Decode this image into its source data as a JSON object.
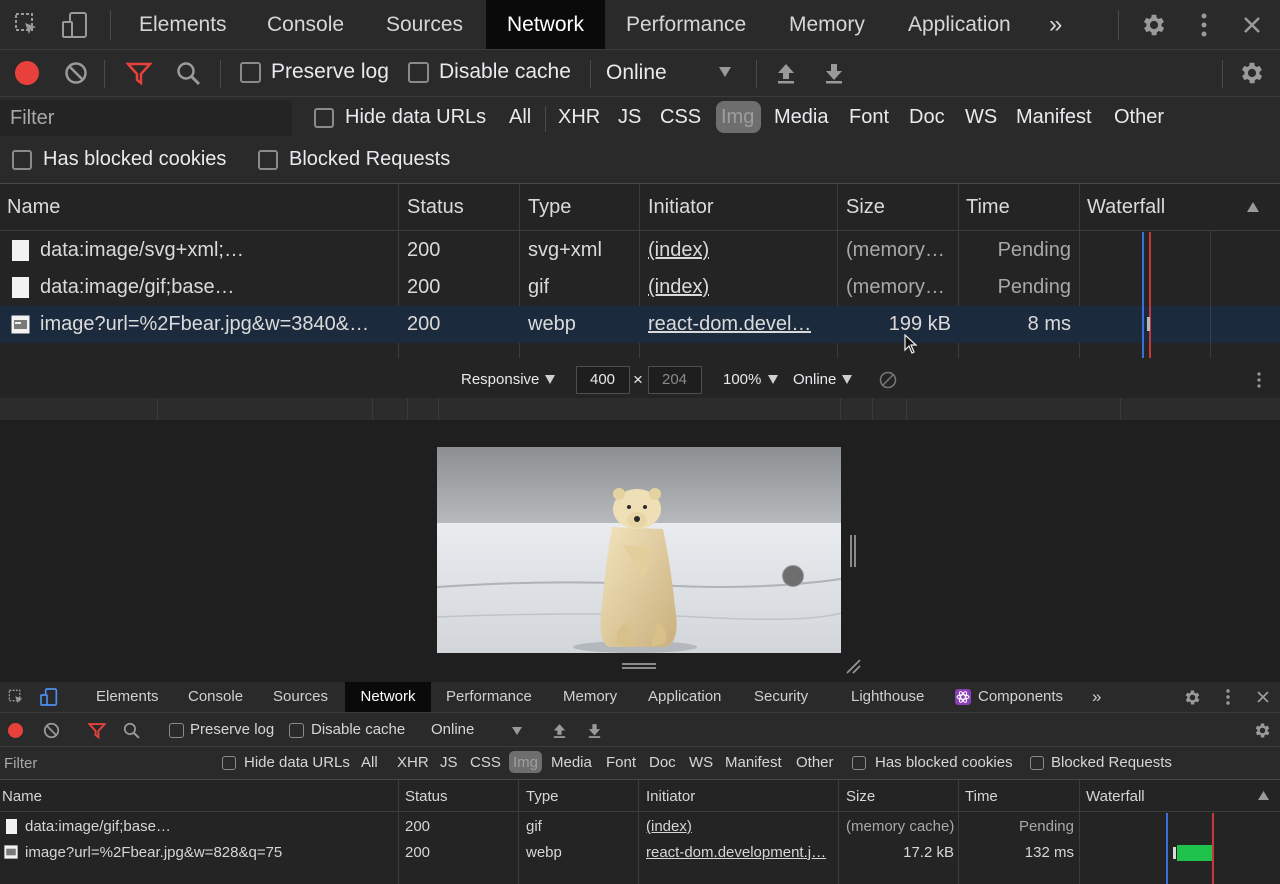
{
  "top": {
    "tabs": [
      "Elements",
      "Console",
      "Sources",
      "Network",
      "Performance",
      "Memory",
      "Application"
    ],
    "active_tab": "Network",
    "more": "»",
    "toolbar": {
      "preserve_log": "Preserve log",
      "disable_cache": "Disable cache",
      "throttle": "Online"
    },
    "filter": {
      "placeholder": "Filter",
      "hide_data_urls": "Hide data URLs",
      "types": [
        "All",
        "XHR",
        "JS",
        "CSS",
        "Img",
        "Media",
        "Font",
        "Doc",
        "WS",
        "Manifest",
        "Other"
      ],
      "active_type": "Img",
      "has_blocked_cookies": "Has blocked cookies",
      "blocked_requests": "Blocked Requests"
    },
    "columns": [
      "Name",
      "Status",
      "Type",
      "Initiator",
      "Size",
      "Time",
      "Waterfall"
    ],
    "rows": [
      {
        "name": "data:image/svg+xml;…",
        "status": "200",
        "type": "svg+xml",
        "initiator": "(index)",
        "size": "(memory…",
        "time": "Pending"
      },
      {
        "name": "data:image/gif;base…",
        "status": "200",
        "type": "gif",
        "initiator": "(index)",
        "size": "(memory…",
        "time": "Pending"
      },
      {
        "name": "image?url=%2Fbear.jpg&w=3840&…",
        "status": "200",
        "type": "webp",
        "initiator": "react-dom.devel…",
        "size": "199 kB",
        "time": "8 ms"
      }
    ]
  },
  "device_toolbar": {
    "mode": "Responsive",
    "width": "400",
    "x": "×",
    "height": "204",
    "zoom": "100%",
    "network": "Online"
  },
  "bottom": {
    "tabs": [
      "Elements",
      "Console",
      "Sources",
      "Network",
      "Performance",
      "Memory",
      "Application",
      "Security",
      "Lighthouse",
      "Components"
    ],
    "active_tab": "Network",
    "more": "»",
    "toolbar": {
      "preserve_log": "Preserve log",
      "disable_cache": "Disable cache",
      "throttle": "Online"
    },
    "filter": {
      "placeholder": "Filter",
      "hide_data_urls": "Hide data URLs",
      "types": [
        "All",
        "XHR",
        "JS",
        "CSS",
        "Img",
        "Media",
        "Font",
        "Doc",
        "WS",
        "Manifest",
        "Other"
      ],
      "has_blocked_cookies": "Has blocked cookies",
      "blocked_requests": "Blocked Requests"
    },
    "columns": [
      "Name",
      "Status",
      "Type",
      "Initiator",
      "Size",
      "Time",
      "Waterfall"
    ],
    "rows": [
      {
        "name": "data:image/gif;base…",
        "status": "200",
        "type": "gif",
        "initiator": "(index)",
        "size": "(memory cache)",
        "time": "Pending"
      },
      {
        "name": "image?url=%2Fbear.jpg&w=828&q=75",
        "status": "200",
        "type": "webp",
        "initiator": "react-dom.development.j…",
        "size": "17.2 kB",
        "time": "132 ms"
      }
    ]
  },
  "colors": {
    "record_red": "#e8413c",
    "filter_red": "#e8413c",
    "active_chip": "#6e6e6e",
    "waterfall_blue": "#3b6fd8",
    "waterfall_red": "#c8383b",
    "waterfall_green": "#1fc24a"
  }
}
